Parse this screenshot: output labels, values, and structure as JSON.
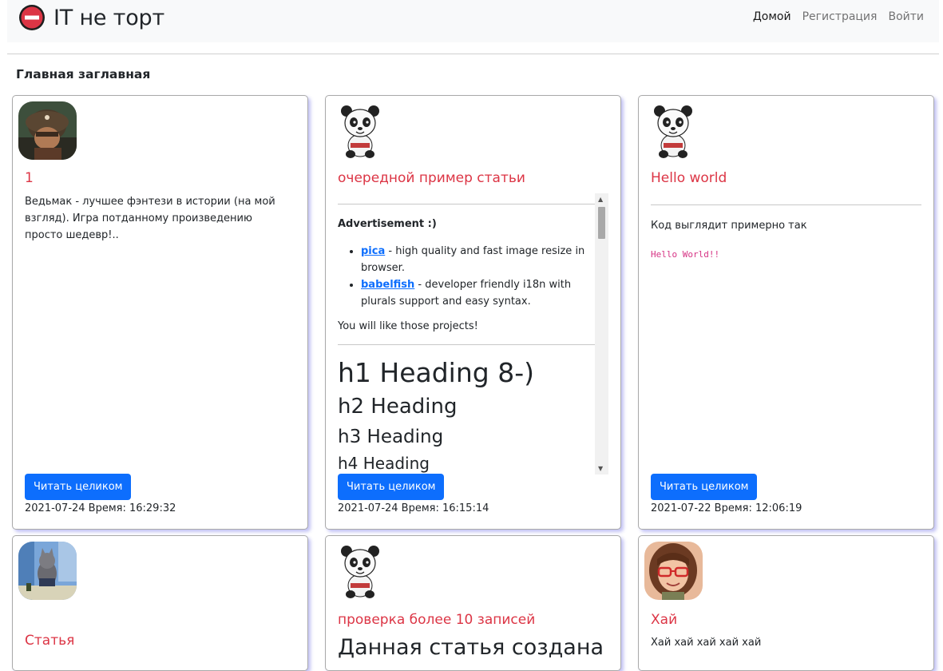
{
  "header": {
    "brand": "IT не торт",
    "nav": [
      "Домой",
      "Регистрация",
      "Войти"
    ],
    "colors": {
      "brand_icon": "#dc3545"
    }
  },
  "page_title": "Главная заглавная",
  "cards": [
    {
      "avatar": "helmet-man-avatar",
      "title": "1",
      "text": "Ведьмак - лучшее фэнтези в истории (на мой взгляд). Игра потданному произведению просто шедевр!..",
      "button": "Читать целиком",
      "date": "2021-07-24 Время: 16:29:32"
    },
    {
      "avatar": "panda-avatar",
      "title": "очередной пример статьи",
      "content": {
        "advertisement": "Advertisement :)",
        "items": [
          {
            "link": "pica",
            "text": " - high quality and fast image resize in browser."
          },
          {
            "link": "babelfish",
            "text": " - developer friendly i18n with plurals support and easy syntax."
          }
        ],
        "like": "You will like those projects!",
        "h1": "h1 Heading 8-)",
        "h2": "h2 Heading",
        "h3": "h3 Heading",
        "h4": "h4 Heading"
      },
      "button": "Читать целиком",
      "date": "2021-07-24 Время: 16:15:14"
    },
    {
      "avatar": "panda-avatar",
      "title": "Hello world",
      "text": "Код выглядит примерно так",
      "code": "Hello World!!",
      "button": "Читать целиком",
      "date": "2021-07-22 Время: 12:06:19"
    },
    {
      "avatar": "cat-avatar",
      "title": "Статья"
    },
    {
      "avatar": "panda-avatar",
      "title": "проверка более 10 записей",
      "heading": "Данная статья создана"
    },
    {
      "avatar": "girl-avatar",
      "title": "Хай",
      "text": "Хай хай хай хай хай"
    }
  ]
}
